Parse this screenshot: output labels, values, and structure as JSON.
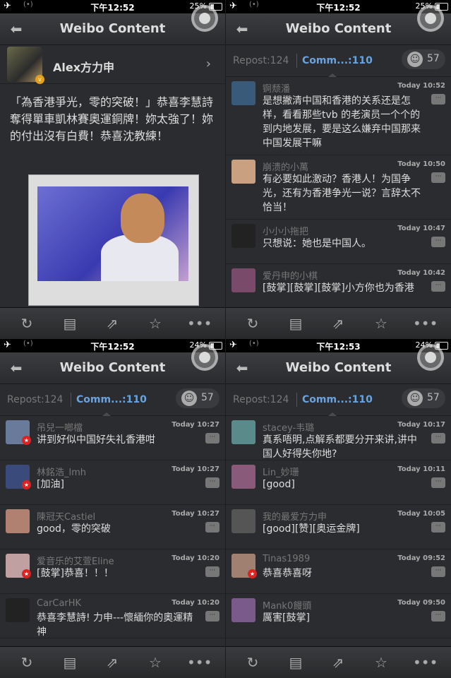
{
  "panels": [
    {
      "status": {
        "time": "下午12:52",
        "battery": "25%"
      },
      "nav": {
        "title": "Weibo Content"
      }
    },
    {
      "status": {
        "time": "下午12:52",
        "battery": "25%"
      },
      "nav": {
        "title": "Weibo Content"
      }
    },
    {
      "status": {
        "time": "下午12:52",
        "battery": "24%"
      },
      "nav": {
        "title": "Weibo Content"
      }
    },
    {
      "status": {
        "time": "下午12:53",
        "battery": "24%"
      },
      "nav": {
        "title": "Weibo Content"
      }
    }
  ],
  "post": {
    "author": "Alex方力申",
    "text": "「為香港爭光，零的突破！」恭喜李慧詩奪得單車凱林賽奧運銅牌！妳太強了！妳的付出沒有白費！恭喜沈教練！"
  },
  "tabs": {
    "repost": "Repost:124",
    "comments": "Comm...:110",
    "likes": "57"
  },
  "comments_1": [
    {
      "name": "锕颓潘",
      "time": "Today 10:52",
      "text": "是想撇清中国和香港的关系还是怎样，看看那些tvb 的老演员一个个的到内地发展，要是这么嫌弃中国那来中国发展干嘛",
      "color": "#3a5a7a"
    },
    {
      "name": "崩溃的小萬",
      "time": "Today 10:50",
      "text": "有必要如此激动？香港人！为国争光，还有为香港争光一说？言辞太不恰当！",
      "color": "#c9a080"
    },
    {
      "name": "小小小拖把",
      "time": "Today 10:47",
      "text": "只想说：她也是中国人。",
      "color": "#222"
    },
    {
      "name": "爱丹申的小棋",
      "time": "Today 10:42",
      "text": "[鼓掌][鼓掌][鼓掌]小方你也为香港",
      "color": "#7a4a6a"
    }
  ],
  "comments_2": [
    {
      "name": "吊兒一啷檔",
      "time": "Today 10:27",
      "text": "讲到好似中国好失礼香港咁",
      "color": "#6a7a9a",
      "vip": true
    },
    {
      "name": "林銘浩_lmh",
      "time": "Today 10:27",
      "text": "[加油]",
      "color": "#3a4a7a",
      "vip": true
    },
    {
      "name": "陳冠天Castiel",
      "time": "Today 10:27",
      "text": "good，零的突破",
      "color": "#b08070"
    },
    {
      "name": "爱音乐的艾萱Eline",
      "time": "Today 10:20",
      "text": "[鼓掌]恭喜！！！",
      "color": "#c0a0a0",
      "vip": true
    },
    {
      "name": "CarCarHK",
      "time": "Today 10:20",
      "text": "恭喜李慧詩! 力申---懷緬你的奧運精神",
      "color": "#222"
    }
  ],
  "comments_3": [
    {
      "name": "stacey-韦璐",
      "time": "Today 10:17",
      "text": "真系唔明,点解系都要分开来讲,讲中国人好得失你地?",
      "color": "#5a8a8a"
    },
    {
      "name": "Lin_妙珊",
      "time": "Today 10:11",
      "text": "[good]",
      "color": "#8a5a7a"
    },
    {
      "name": "我的最爱方力申",
      "time": "Today 10:05",
      "text": "[good][赞][奥运金牌]",
      "color": "#555"
    },
    {
      "name": "Tinas1989",
      "time": "Today 09:52",
      "text": "恭喜恭喜呀",
      "color": "#a08070",
      "vip": true
    },
    {
      "name": "Mank0饅頭",
      "time": "Today 09:50",
      "text": "厲害[鼓掌]",
      "color": "#7a5a8a"
    }
  ],
  "icons": {
    "back": "back-arrow-icon",
    "refresh": "refresh-icon",
    "comment": "comment-icon",
    "share": "share-icon",
    "favorite": "star-icon",
    "more": "more-icon"
  }
}
